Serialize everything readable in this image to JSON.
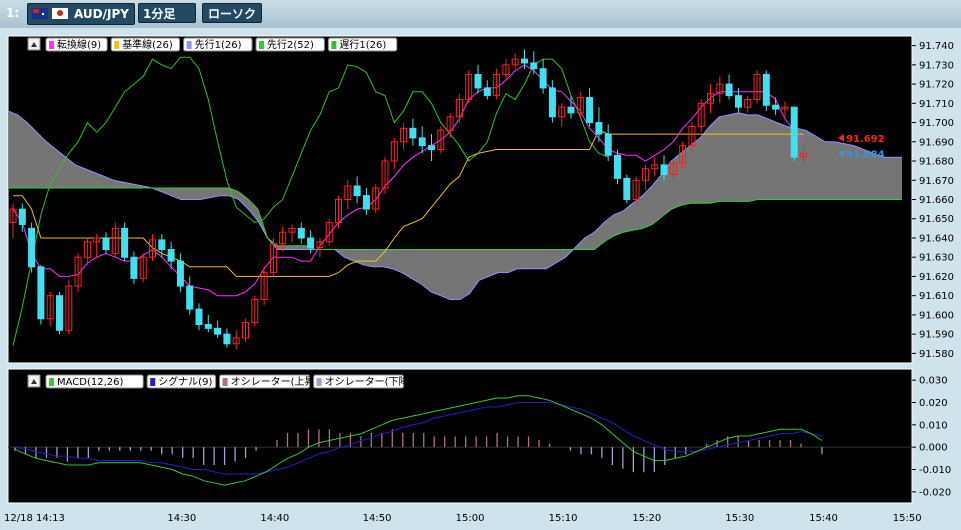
{
  "titlebar": {
    "window_index": "1:",
    "pair": "AUD/JPY",
    "timeframe": "1分足",
    "chart_type": "ローソク"
  },
  "colors": {
    "background": "#000000",
    "up_candle": "#ff2020",
    "down_candle": "#40e0f0",
    "tenkan": "#ff30ff",
    "kijun": "#f0c020",
    "senkou1": "#9090ff",
    "senkou2": "#30d030",
    "chikou": "#30c030",
    "cloud": "#8a8a8a",
    "macd": "#40c040",
    "signal": "#2020c0",
    "osc_up": "#b07080",
    "osc_down": "#a0a0d0"
  },
  "chart_data": [
    {
      "type": "candlestick",
      "legend_position": "top-left",
      "legend": [
        "転換線(9)",
        "基準線(26)",
        "先行1(26)",
        "先行2(52)",
        "遅行1(26)"
      ],
      "y_ticks": [
        "91.740",
        "91.730",
        "91.720",
        "91.710",
        "91.700",
        "91.690",
        "91.680",
        "91.670",
        "91.660",
        "91.650",
        "91.640",
        "91.630",
        "91.620",
        "91.610",
        "91.600",
        "91.590",
        "91.580"
      ],
      "ylim": [
        91.575,
        91.745
      ],
      "x_ticks": [
        "12/18 14:13",
        "14:30",
        "14:40",
        "14:50",
        "15:00",
        "15:10",
        "15:20",
        "15:30",
        "15:40",
        "15:50"
      ],
      "price_labels": [
        {
          "value": "91.692",
          "color": "#ff2020"
        },
        {
          "value": "91.684",
          "color": "#4090e0"
        }
      ],
      "candles": [
        [
          91.648,
          91.658,
          91.64,
          91.655
        ],
        [
          91.655,
          91.658,
          91.643,
          91.647
        ],
        [
          91.645,
          91.648,
          91.622,
          91.625
        ],
        [
          91.625,
          91.626,
          91.595,
          91.598
        ],
        [
          91.598,
          91.612,
          91.594,
          91.61
        ],
        [
          91.61,
          91.612,
          91.59,
          91.592
        ],
        [
          91.592,
          91.618,
          91.59,
          91.615
        ],
        [
          91.615,
          91.632,
          91.612,
          91.63
        ],
        [
          91.63,
          91.64,
          91.626,
          91.638
        ],
        [
          91.638,
          91.642,
          91.63,
          91.64
        ],
        [
          91.64,
          91.643,
          91.632,
          91.634
        ],
        [
          91.632,
          91.648,
          91.63,
          91.645
        ],
        [
          91.645,
          91.648,
          91.628,
          91.63
        ],
        [
          91.63,
          91.633,
          91.616,
          91.619
        ],
        [
          91.619,
          91.632,
          91.617,
          91.63
        ],
        [
          91.63,
          91.642,
          91.628,
          91.639
        ],
        [
          91.639,
          91.642,
          91.63,
          91.634
        ],
        [
          91.634,
          91.638,
          91.624,
          91.628
        ],
        [
          91.628,
          91.632,
          91.612,
          91.615
        ],
        [
          91.615,
          91.62,
          91.6,
          91.603
        ],
        [
          91.603,
          91.606,
          91.592,
          91.595
        ],
        [
          91.595,
          91.6,
          91.591,
          91.593
        ],
        [
          91.593,
          91.597,
          91.588,
          91.59
        ],
        [
          91.59,
          91.593,
          91.583,
          91.585
        ],
        [
          91.585,
          91.592,
          91.582,
          91.588
        ],
        [
          91.588,
          91.598,
          91.586,
          91.596
        ],
        [
          91.596,
          91.61,
          91.594,
          91.608
        ],
        [
          91.608,
          91.625,
          91.605,
          91.622
        ],
        [
          91.622,
          91.64,
          91.62,
          91.637
        ],
        [
          91.637,
          91.646,
          91.633,
          91.643
        ],
        [
          91.643,
          91.647,
          91.638,
          91.645
        ],
        [
          91.645,
          91.648,
          91.637,
          91.64
        ],
        [
          91.64,
          91.644,
          91.632,
          91.635
        ],
        [
          91.635,
          91.64,
          91.63,
          91.638
        ],
        [
          91.638,
          91.65,
          91.636,
          91.648
        ],
        [
          91.648,
          91.662,
          91.645,
          91.66
        ],
        [
          91.66,
          91.67,
          91.655,
          91.667
        ],
        [
          91.667,
          91.672,
          91.658,
          91.662
        ],
        [
          91.662,
          91.666,
          91.652,
          91.655
        ],
        [
          91.655,
          91.668,
          91.653,
          91.666
        ],
        [
          91.666,
          91.682,
          91.663,
          91.68
        ],
        [
          91.68,
          91.692,
          91.676,
          91.69
        ],
        [
          91.69,
          91.7,
          91.686,
          91.697
        ],
        [
          91.697,
          91.702,
          91.688,
          91.692
        ],
        [
          91.692,
          91.698,
          91.684,
          91.688
        ],
        [
          91.688,
          91.694,
          91.68,
          91.686
        ],
        [
          91.686,
          91.698,
          91.684,
          91.696
        ],
        [
          91.696,
          91.705,
          91.692,
          91.703
        ],
        [
          91.703,
          91.715,
          91.7,
          91.712
        ],
        [
          91.712,
          91.727,
          91.71,
          91.725
        ],
        [
          91.725,
          91.73,
          91.715,
          91.718
        ],
        [
          91.718,
          91.722,
          91.712,
          91.714
        ],
        [
          91.714,
          91.728,
          91.712,
          91.725
        ],
        [
          91.725,
          91.733,
          91.722,
          91.73
        ],
        [
          91.73,
          91.736,
          91.728,
          91.733
        ],
        [
          91.733,
          91.738,
          91.728,
          91.731
        ],
        [
          91.731,
          91.737,
          91.725,
          91.728
        ],
        [
          91.728,
          91.733,
          91.715,
          91.718
        ],
        [
          91.718,
          91.722,
          91.7,
          91.703
        ],
        [
          91.703,
          91.71,
          91.698,
          91.708
        ],
        [
          91.708,
          91.714,
          91.702,
          91.705
        ],
        [
          91.705,
          91.716,
          91.703,
          91.713
        ],
        [
          91.713,
          91.718,
          91.698,
          91.7
        ],
        [
          91.7,
          91.708,
          91.69,
          91.694
        ],
        [
          91.694,
          91.699,
          91.68,
          91.683
        ],
        [
          91.683,
          91.686,
          91.668,
          91.671
        ],
        [
          91.671,
          91.673,
          91.658,
          91.66
        ],
        [
          91.66,
          91.672,
          91.658,
          91.67
        ],
        [
          91.67,
          91.678,
          91.665,
          91.676
        ],
        [
          91.676,
          91.682,
          91.672,
          91.678
        ],
        [
          91.678,
          91.683,
          91.67,
          91.673
        ],
        [
          91.673,
          91.681,
          91.67,
          91.679
        ],
        [
          91.679,
          91.69,
          91.676,
          91.688
        ],
        [
          91.688,
          91.7,
          91.685,
          91.698
        ],
        [
          91.698,
          91.712,
          91.695,
          91.71
        ],
        [
          91.71,
          91.72,
          91.705,
          91.715
        ],
        [
          91.715,
          91.724,
          91.71,
          91.72
        ],
        [
          91.72,
          91.725,
          91.712,
          91.714
        ],
        [
          91.714,
          91.718,
          91.705,
          91.708
        ],
        [
          91.708,
          91.714,
          91.705,
          91.712
        ],
        [
          91.712,
          91.727,
          91.71,
          91.725
        ],
        [
          91.725,
          91.727,
          91.706,
          91.709
        ],
        [
          91.709,
          91.713,
          91.704,
          91.707
        ],
        [
          91.707,
          91.711,
          91.703,
          91.708
        ],
        [
          91.708,
          91.7,
          91.68,
          91.682
        ],
        [
          91.682,
          91.688,
          91.678,
          91.684
        ]
      ],
      "tenkan": [
        91.655,
        91.648,
        91.632,
        91.624,
        91.624,
        91.62,
        91.62,
        91.621,
        91.627,
        91.63,
        91.632,
        91.63,
        91.628,
        91.628,
        91.631,
        91.634,
        91.63,
        91.625,
        91.62,
        91.615,
        91.614,
        91.613,
        91.61,
        91.61,
        91.61,
        91.612,
        91.616,
        91.624,
        91.63,
        91.63,
        91.63,
        91.628,
        91.628,
        91.636,
        91.642,
        91.648,
        91.652,
        91.655,
        91.656,
        91.66,
        91.667,
        91.672,
        91.678,
        91.682,
        91.685,
        91.688,
        91.691,
        91.695,
        91.702,
        91.712,
        91.716,
        91.718,
        91.718,
        91.722,
        91.727,
        91.73,
        91.727,
        91.722,
        91.717,
        91.716,
        91.711,
        91.706,
        91.697,
        91.692,
        91.686,
        91.684,
        91.683,
        91.683,
        91.68,
        91.683,
        91.686,
        91.69,
        91.697,
        91.702,
        91.708,
        91.713,
        91.716,
        91.716,
        91.716,
        91.716,
        91.716,
        91.716,
        91.712,
        91.702,
        91.696,
        91.69
      ],
      "kijun": [
        91.662,
        91.662,
        91.655,
        91.64,
        91.64,
        91.64,
        91.64,
        91.64,
        91.64,
        91.64,
        91.64,
        91.64,
        91.64,
        91.64,
        91.64,
        91.635,
        91.632,
        91.63,
        91.628,
        91.625,
        91.625,
        91.625,
        91.625,
        91.625,
        91.62,
        91.62,
        91.62,
        91.62,
        91.62,
        91.62,
        91.62,
        91.62,
        91.62,
        91.62,
        91.62,
        91.622,
        91.626,
        91.628,
        91.628,
        91.628,
        91.633,
        91.64,
        91.646,
        91.648,
        91.65,
        91.656,
        91.662,
        91.668,
        91.672,
        91.682,
        91.684,
        91.685,
        91.686,
        91.686,
        91.686,
        91.686,
        91.686,
        91.686,
        91.686,
        91.686,
        91.686,
        91.686,
        91.686,
        91.696,
        91.694,
        91.694,
        91.694,
        91.694,
        91.694,
        91.694,
        91.694,
        91.694,
        91.694,
        91.694,
        91.694,
        91.694,
        91.694,
        91.694,
        91.694,
        91.694,
        91.694,
        91.694,
        91.694,
        91.694,
        91.694,
        91.694
      ],
      "chikou": [
        91.584,
        91.604,
        91.628,
        91.652,
        91.668,
        91.676,
        91.684,
        91.69,
        91.7,
        91.695,
        91.7,
        91.708,
        91.716,
        91.72,
        91.724,
        91.733,
        91.73,
        91.728,
        91.734,
        91.734,
        91.728,
        91.712,
        91.69,
        91.67,
        91.656,
        91.652,
        91.648,
        91.65,
        91.656,
        91.66,
        91.672,
        91.684,
        91.696,
        91.704,
        91.716,
        91.718,
        91.73,
        91.729,
        91.726,
        91.716,
        91.714,
        91.7,
        91.706,
        91.716,
        91.716,
        91.71,
        91.7,
        91.694,
        91.688,
        91.68,
        91.684,
        91.69,
        91.705,
        91.715,
        91.712,
        91.72,
        91.73,
        91.733,
        91.733,
        91.728,
        91.714,
        91.703,
        91.69,
        91.684,
        91.682
      ],
      "senkou1": [
        91.706,
        91.704,
        91.7,
        91.695,
        91.69,
        91.686,
        91.682,
        91.678,
        91.676,
        91.674,
        91.672,
        91.67,
        91.669,
        91.668,
        91.667,
        91.666,
        91.664,
        91.662,
        91.66,
        91.66,
        91.66,
        91.661,
        91.662,
        91.662,
        91.66,
        91.655,
        91.649,
        91.64,
        91.634,
        91.634,
        91.634,
        91.634,
        91.634,
        91.634,
        91.634,
        91.63,
        91.628,
        91.626,
        91.625,
        91.625,
        91.624,
        91.622,
        91.619,
        91.616,
        91.612,
        91.61,
        91.608,
        91.608,
        91.611,
        91.618,
        91.62,
        91.622,
        91.622,
        91.624,
        91.624,
        91.624,
        91.624,
        91.627,
        91.63,
        91.635,
        91.64,
        91.643,
        91.648,
        91.652,
        91.654,
        91.658,
        91.662,
        91.667,
        91.673,
        91.68,
        91.684,
        91.688,
        91.692,
        91.698,
        91.703,
        91.704,
        91.705,
        91.704,
        91.704,
        91.702,
        91.7,
        91.698,
        91.697,
        91.696,
        91.693,
        91.69,
        91.69,
        91.689,
        91.688,
        91.686,
        91.684,
        91.682,
        91.682,
        91.682
      ],
      "senkou2": [
        91.666,
        91.666,
        91.666,
        91.666,
        91.666,
        91.666,
        91.666,
        91.666,
        91.666,
        91.666,
        91.666,
        91.666,
        91.666,
        91.666,
        91.666,
        91.666,
        91.666,
        91.666,
        91.666,
        91.666,
        91.666,
        91.666,
        91.666,
        91.666,
        91.664,
        91.66,
        91.655,
        91.64,
        91.636,
        91.636,
        91.636,
        91.636,
        91.634,
        91.634,
        91.634,
        91.634,
        91.634,
        91.634,
        91.634,
        91.634,
        91.634,
        91.634,
        91.634,
        91.634,
        91.634,
        91.634,
        91.634,
        91.634,
        91.634,
        91.634,
        91.634,
        91.634,
        91.634,
        91.634,
        91.634,
        91.634,
        91.634,
        91.634,
        91.634,
        91.634,
        91.634,
        91.634,
        91.638,
        91.641,
        91.643,
        91.644,
        91.645,
        91.647,
        91.651,
        91.655,
        91.657,
        91.658,
        91.658,
        91.658,
        91.659,
        91.659,
        91.659,
        91.659,
        91.66,
        91.66,
        91.66,
        91.66,
        91.66,
        91.66,
        91.66,
        91.66,
        91.66,
        91.66,
        91.66,
        91.66,
        91.66,
        91.66,
        91.66,
        91.66
      ]
    },
    {
      "type": "macd",
      "legend": [
        "MACD(12,26)",
        "シグナル(9)",
        "オシレーター(上昇)",
        "オシレーター(下降)"
      ],
      "y_ticks": [
        "0.030",
        "0.020",
        "0.010",
        "0.000",
        "-0.010",
        "-0.020"
      ],
      "ylim": [
        -0.025,
        0.035
      ],
      "macd": [
        -0.001,
        -0.003,
        -0.005,
        -0.006,
        -0.007,
        -0.008,
        -0.008,
        -0.008,
        -0.007,
        -0.007,
        -0.007,
        -0.007,
        -0.007,
        -0.008,
        -0.009,
        -0.01,
        -0.012,
        -0.013,
        -0.015,
        -0.016,
        -0.017,
        -0.016,
        -0.015,
        -0.013,
        -0.011,
        -0.008,
        -0.005,
        -0.003,
        0.0,
        0.002,
        0.003,
        0.004,
        0.005,
        0.006,
        0.008,
        0.01,
        0.012,
        0.013,
        0.014,
        0.015,
        0.016,
        0.017,
        0.018,
        0.019,
        0.02,
        0.021,
        0.022,
        0.022,
        0.023,
        0.023,
        0.022,
        0.021,
        0.019,
        0.017,
        0.015,
        0.013,
        0.01,
        0.006,
        0.002,
        -0.002,
        -0.004,
        -0.006,
        -0.006,
        -0.005,
        -0.004,
        -0.002,
        0.0,
        0.002,
        0.004,
        0.005,
        0.005,
        0.006,
        0.007,
        0.008,
        0.008,
        0.008,
        0.006,
        0.003
      ],
      "signal": [
        0.0,
        -0.001,
        -0.002,
        -0.003,
        -0.004,
        -0.004,
        -0.005,
        -0.005,
        -0.006,
        -0.006,
        -0.006,
        -0.006,
        -0.006,
        -0.007,
        -0.007,
        -0.008,
        -0.009,
        -0.01,
        -0.01,
        -0.011,
        -0.012,
        -0.012,
        -0.012,
        -0.012,
        -0.011,
        -0.01,
        -0.009,
        -0.007,
        -0.005,
        -0.003,
        -0.002,
        0.0,
        0.001,
        0.003,
        0.004,
        0.006,
        0.007,
        0.009,
        0.01,
        0.011,
        0.013,
        0.014,
        0.015,
        0.016,
        0.017,
        0.018,
        0.018,
        0.019,
        0.02,
        0.02,
        0.02,
        0.02,
        0.019,
        0.018,
        0.017,
        0.015,
        0.013,
        0.011,
        0.008,
        0.005,
        0.003,
        0.001,
        -0.001,
        -0.002,
        -0.002,
        -0.002,
        -0.001,
        0.0,
        0.001,
        0.002,
        0.003,
        0.004,
        0.005,
        0.006,
        0.006,
        0.007,
        0.006,
        0.005
      ]
    }
  ]
}
